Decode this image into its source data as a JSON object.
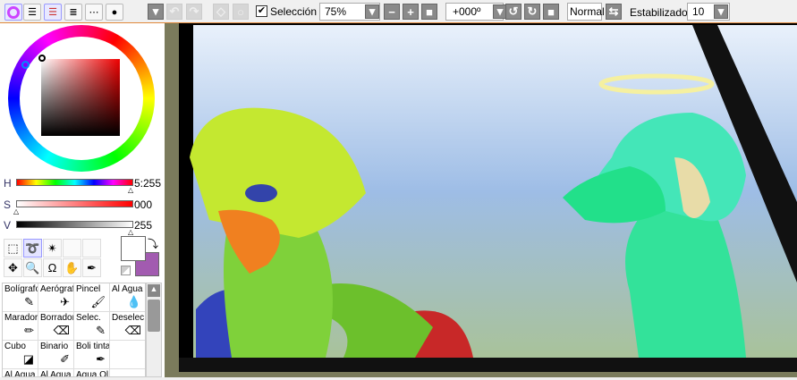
{
  "toolbar": {
    "selection_label": "Selección",
    "selection_checked": true,
    "zoom": "75%",
    "rotation": "+000º",
    "blend_mode": "Normal",
    "stabilizer_label": "Estabilizador",
    "stabilizer_value": "10"
  },
  "color": {
    "h_label": "H",
    "s_label": "S",
    "v_label": "V",
    "h_value": "5:255",
    "s_value": "000",
    "v_value": "255",
    "primary": "#ffffff",
    "secondary": "#a25bb0"
  },
  "brushes": [
    {
      "label": "Bolígrafo",
      "icon": "pen-icon"
    },
    {
      "label": "Aerógrafo",
      "icon": "airbrush-icon"
    },
    {
      "label": "Pincel",
      "icon": "brush-icon"
    },
    {
      "label": "Al Agua",
      "icon": "watercolor-icon"
    },
    {
      "label": "Marador",
      "icon": "marker-icon"
    },
    {
      "label": "Borrador",
      "icon": "eraser-icon"
    },
    {
      "label": "Selec.",
      "icon": "select-pen-icon"
    },
    {
      "label": "Deselec.",
      "icon": "deselect-icon"
    },
    {
      "label": "Cubo",
      "icon": "bucket-icon"
    },
    {
      "label": "Binario",
      "icon": "binary-pen-icon"
    },
    {
      "label": "Boli tinta",
      "icon": "ink-pen-icon"
    },
    {
      "label": "",
      "icon": ""
    },
    {
      "label": "Al Agua",
      "icon": ""
    },
    {
      "label": "Al Agua",
      "icon": ""
    },
    {
      "label": "Agua Ol",
      "icon": ""
    }
  ]
}
